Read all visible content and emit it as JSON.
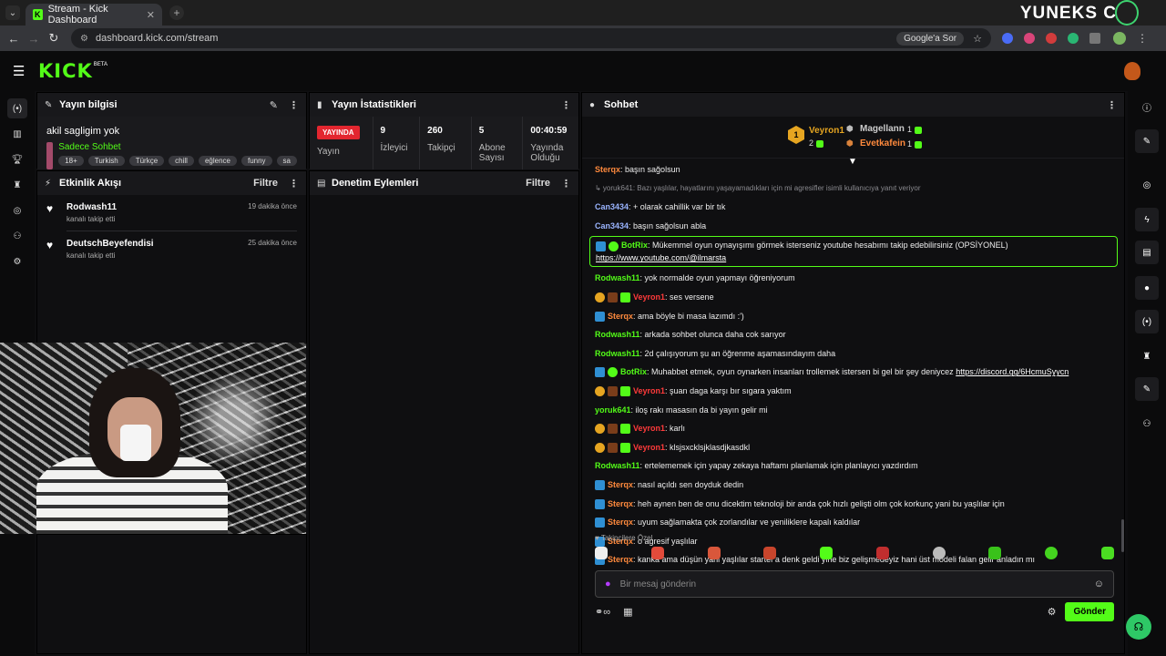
{
  "browser": {
    "tab_title": "Stream - Kick Dashboard",
    "url": "dashboard.kick.com/stream",
    "google_sor": "Google'a Sor",
    "overlay_brand": "YUNEKS C"
  },
  "header": {
    "logo": "KICK",
    "beta": "BETA"
  },
  "stream_info": {
    "title": "Yayın bilgisi",
    "stream_title": "akil sagligim yok",
    "category": "Sadece Sohbet",
    "tags": [
      "18+",
      "Turkish",
      "Türkçe",
      "chill",
      "eğlence",
      "funny",
      "sa"
    ]
  },
  "stream_stats": {
    "title": "Yayın İstatistikleri",
    "live_label": "YAYINDA",
    "stats": [
      {
        "value": "",
        "label": "Yayın"
      },
      {
        "value": "9",
        "label": "İzleyici"
      },
      {
        "value": "260",
        "label": "Takipçi"
      },
      {
        "value": "5",
        "label": "Abone Sayısı"
      },
      {
        "value": "00:40:59",
        "label": "Yayında Olduğu"
      }
    ]
  },
  "activity": {
    "title": "Etkinlik Akışı",
    "filter": "Filtre",
    "events": [
      {
        "name": "Rodwash11",
        "action": "kanalı takip etti",
        "time": "19 dakika önce"
      },
      {
        "name": "DeutschBeyefendisi",
        "action": "kanalı takip etti",
        "time": "25 dakika önce"
      }
    ]
  },
  "moderation": {
    "title": "Denetim Eylemleri",
    "filter": "Filtre"
  },
  "chat": {
    "title": "Sohbet",
    "leaderboard": [
      {
        "rank": "1",
        "name": "Veyron1",
        "count": "2"
      },
      {
        "name": "Magellann",
        "count": "1"
      },
      {
        "name": "Evetkafein",
        "count": "1"
      }
    ],
    "messages": [
      {
        "user": "Sterqx",
        "text": "başın sağolsun",
        "color": "#ff8a3d"
      },
      {
        "system": true,
        "text": "↳ yoruk641: Bazı yaşlılar, hayatlarını yaşayamadıkları için mi agresifler isimli kullanıcıya yanıt veriyor"
      },
      {
        "user": "Can3434",
        "text": "+ olarak cahillik var bir tık",
        "color": "#9ab4ff"
      },
      {
        "user": "Can3434",
        "text": "başın sağolsun abla",
        "color": "#9ab4ff"
      },
      {
        "user": "BotRix",
        "text": "Mükemmel oyun oynayışımı görmek isterseniz youtube hesabımı takip edebilirsiniz (OPSİYONEL)",
        "link": "https://www.youtube.com/@ilmarsta",
        "color": "#53fc18",
        "boxed": true
      },
      {
        "user": "Rodwash11",
        "text": "yok normalde oyun yapmayı öğreniyorum",
        "color": "#53fc18"
      },
      {
        "user": "Veyron1",
        "text": "ses versene",
        "color": "#ff3a3a",
        "badges": "gold"
      },
      {
        "user": "Sterqx",
        "text": "ama böyle bi masa lazımdı :')",
        "color": "#ff8a3d",
        "badges": "bot"
      },
      {
        "user": "Rodwash11",
        "text": "arkada sohbet olunca daha cok sarıyor",
        "color": "#53fc18"
      },
      {
        "user": "Rodwash11",
        "text": "2d çalışıyorum şu an öğrenme aşamasındayım daha",
        "color": "#53fc18"
      },
      {
        "user": "BotRix",
        "text": "Muhabbet etmek, oyun oynarken insanları trollemek istersen bi gel bir şey deniycez",
        "link": "https://discord.gg/6HcmuSyycn",
        "color": "#53fc18",
        "badges": "botrix"
      },
      {
        "user": "Veyron1",
        "text": "şuan daga karşı bır sıgara yaktım",
        "color": "#ff3a3a",
        "badges": "gold"
      },
      {
        "user": "yoruk641",
        "text": "iloş rakı masasın da bi yayın gelir mi",
        "color": "#53fc18"
      },
      {
        "user": "Veyron1",
        "text": "karlı",
        "color": "#ff3a3a",
        "badges": "gold"
      },
      {
        "user": "Veyron1",
        "text": "klsjsxcklsjklasdjkasdkl",
        "color": "#ff3a3a",
        "badges": "gold"
      },
      {
        "user": "Rodwash11",
        "text": "ertelememek için yapay zekaya haftamı planlamak için planlayıcı yazdırdım",
        "color": "#53fc18"
      },
      {
        "user": "Sterqx",
        "text": "nasıl açıldı sen doyduk dedin",
        "color": "#ff8a3d",
        "badges": "bot"
      },
      {
        "user": "Sterqx",
        "text": "heh aynen ben de onu dicektim teknoloji bir anda çok hızlı gelişti olm çok korkunç yani bu yaşlılar için",
        "color": "#ff8a3d",
        "badges": "bot"
      },
      {
        "user": "Sterqx",
        "text": "uyum sağlamakta çok zorlandılar ve yeniliklere kapalı kaldılar",
        "color": "#ff8a3d",
        "badges": "bot"
      },
      {
        "user": "Sterqx",
        "text": "o agresif yaşlılar",
        "color": "#ff8a3d",
        "badges": "bot"
      },
      {
        "user": "Sterqx",
        "text": "kanka ama düşün yani yaşlılar starter'a denk geldi yine biz gelişmedeyiz hani üst modeli falan gelir anladın mı",
        "color": "#ff8a3d",
        "badges": "bot"
      }
    ],
    "followers_only": "Takipçilere Özel",
    "input_placeholder": "Bir mesaj gönderin",
    "send_label": "Gönder"
  }
}
